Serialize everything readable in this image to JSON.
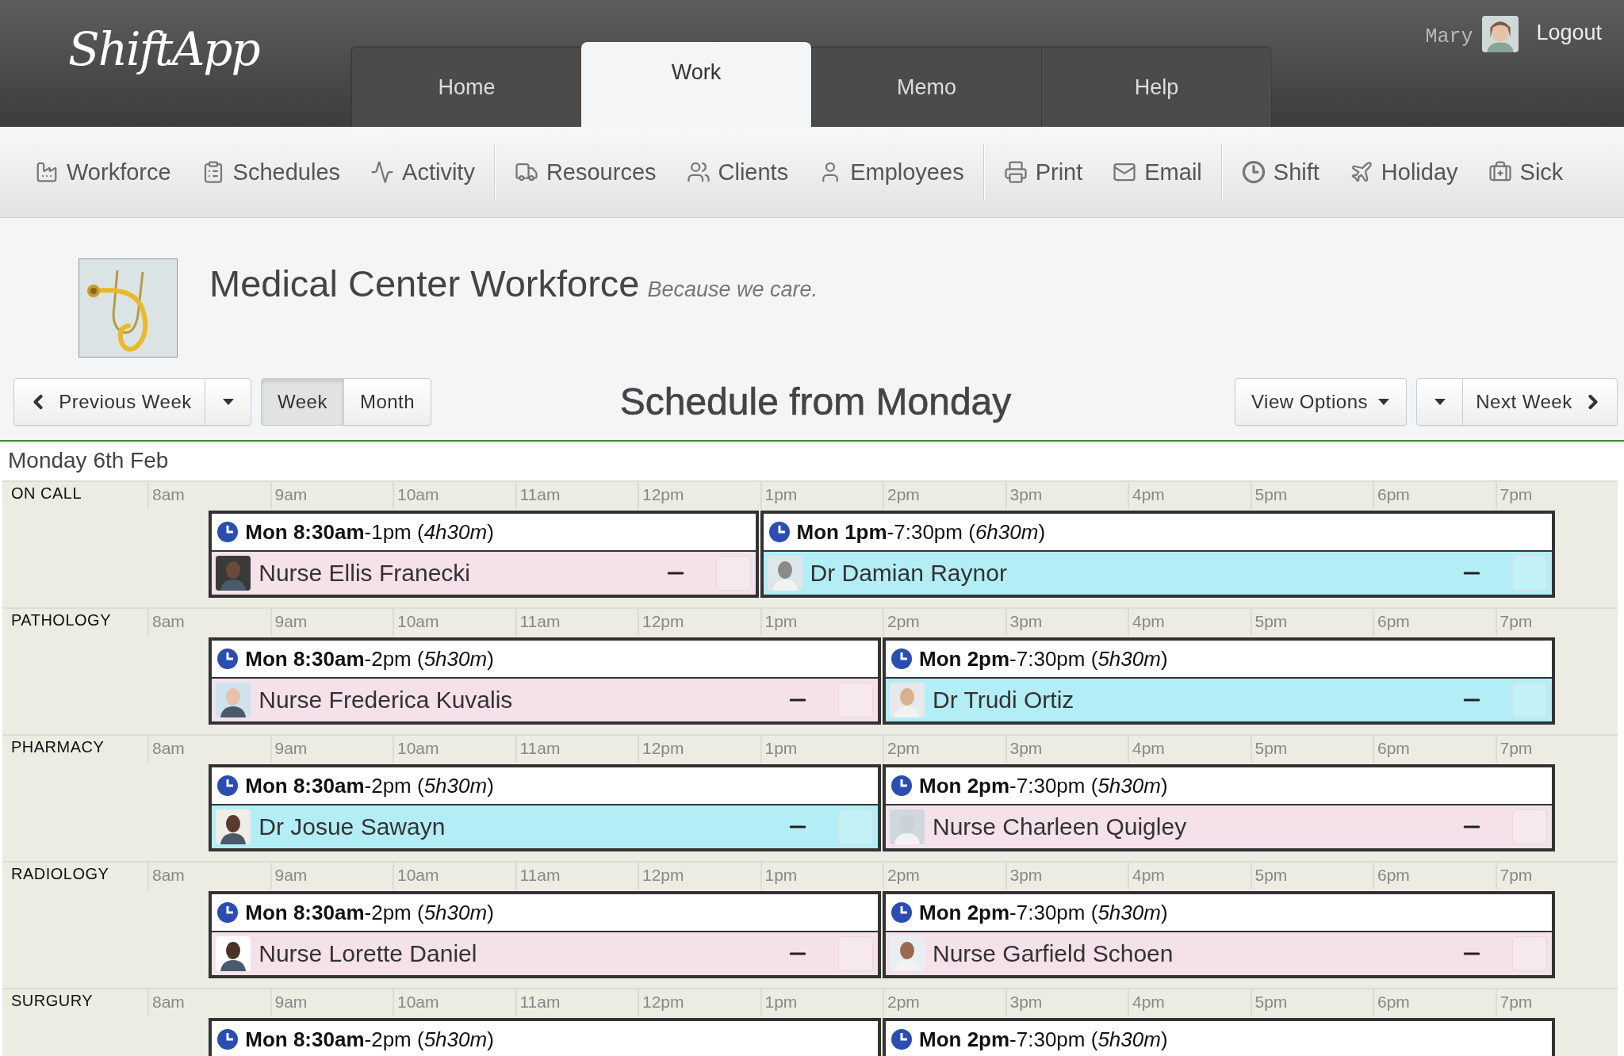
{
  "app": {
    "logo": "ShiftApp",
    "tabs": [
      {
        "label": "Home",
        "selected": false
      },
      {
        "label": "Work",
        "selected": true
      },
      {
        "label": "Memo",
        "selected": false
      },
      {
        "label": "Help",
        "selected": false
      }
    ],
    "user": {
      "name": "Mary",
      "logout": "Logout"
    }
  },
  "toolbar": {
    "groups": [
      {
        "items": [
          "Workforce",
          "Schedules",
          "Activity"
        ]
      },
      {
        "items": [
          "Resources",
          "Clients",
          "Employees"
        ]
      },
      {
        "items": [
          "Print",
          "Email"
        ]
      },
      {
        "items": [
          "Shift",
          "Holiday",
          "Sick"
        ]
      }
    ]
  },
  "organization": {
    "title": "Medical Center Workforce",
    "tagline": "Because we care."
  },
  "controls": {
    "previous": "Previous Week",
    "views": [
      {
        "label": "Week",
        "selected": true
      },
      {
        "label": "Month",
        "selected": false
      }
    ],
    "heading": "Schedule from Monday",
    "view_options": "View Options",
    "next": "Next Week"
  },
  "schedule": {
    "date": "Monday 6th Feb",
    "sections": [
      {
        "name": "ON CALL",
        "hours": [
          "8am",
          "9am",
          "10am",
          "11am",
          "12pm",
          "1pm",
          "2pm",
          "3pm",
          "4pm",
          "5pm",
          "6pm",
          "7pm"
        ],
        "shifts": [
          {
            "time": "**Mon 8:30am**-1pm (*4h30m*)",
            "employee": {
              "name": "Nurse Ellis Franecki",
              "color": "#f5e1ea",
              "checked": false
            }
          },
          {
            "time": "**Mon 1pm**-7:30pm (*6h30m*)",
            "employee": {
              "name": "Dr Damian Raynor",
              "color": "#b3eef6",
              "checked": false
            }
          }
        ]
      },
      {
        "name": "PATHOLOGY",
        "hours": [
          "8am",
          "9am",
          "10am",
          "11am",
          "12pm",
          "1pm",
          "2pm",
          "3pm",
          "4pm",
          "5pm",
          "6pm",
          "7pm"
        ],
        "shifts": [
          {
            "time": "**Mon 8:30am**-2pm (*5h30m*)",
            "employee": {
              "name": "Nurse Frederica Kuvalis",
              "color": "#f5e1ea",
              "checked": false
            }
          },
          {
            "time": "**Mon 2pm**-7:30pm (*5h30m*)",
            "employee": {
              "name": "Dr Trudi Ortiz",
              "color": "#b3eef6",
              "checked": false
            }
          }
        ]
      },
      {
        "name": "PHARMACY",
        "hours": [
          "8am",
          "9am",
          "10am",
          "11am",
          "12pm",
          "1pm",
          "2pm",
          "3pm",
          "4pm",
          "5pm",
          "6pm",
          "7pm"
        ],
        "shifts": [
          {
            "time": "**Mon 8:30am**-2pm (*5h30m*)",
            "employee": {
              "name": "Dr Josue Sawayn",
              "color": "#b3eef6",
              "checked": false
            }
          },
          {
            "time": "**Mon 2pm**-7:30pm (*5h30m*)",
            "employee": {
              "name": "Nurse Charleen Quigley",
              "color": "#f5e1ea",
              "checked": false
            }
          }
        ]
      },
      {
        "name": "RADIOLOGY",
        "hours": [
          "8am",
          "9am",
          "10am",
          "11am",
          "12pm",
          "1pm",
          "2pm",
          "3pm",
          "4pm",
          "5pm",
          "6pm",
          "7pm"
        ],
        "shifts": [
          {
            "time": "**Mon 8:30am**-2pm (*5h30m*)",
            "employee": {
              "name": "Nurse Lorette Daniel",
              "color": "#f5e1ea",
              "checked": false
            }
          },
          {
            "time": "**Mon 2pm**-7:30pm (*5h30m*)",
            "employee": {
              "name": "Nurse Garfield Schoen",
              "color": "#f5e1ea",
              "checked": false
            }
          }
        ]
      },
      {
        "name": "SURGURY",
        "hours": [
          "8am",
          "9am",
          "10am",
          "11am",
          "12pm",
          "1pm",
          "2pm",
          "3pm",
          "4pm",
          "5pm",
          "6pm",
          "7pm"
        ],
        "shifts": [
          {
            "time": "**Mon 8:30am**-2pm (*5h30m*)"
          },
          {
            "time": "**Mon 2pm**-7:30pm (*5h30m*)"
          }
        ]
      }
    ]
  }
}
